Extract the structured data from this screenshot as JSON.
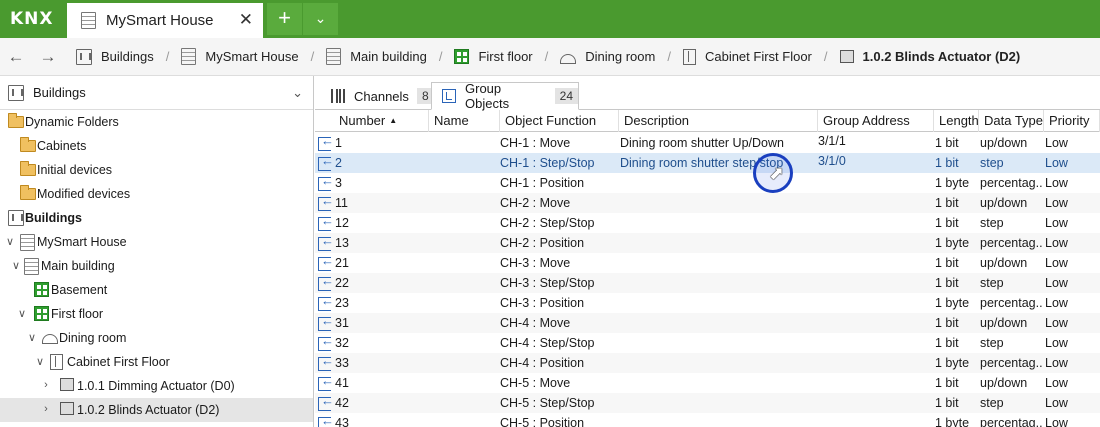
{
  "app": {
    "logo": "KNX"
  },
  "tab": {
    "title": "MySmart House",
    "close": "✕",
    "add": "+",
    "dropdown": "⌄"
  },
  "breadcrumb": {
    "back": "←",
    "forward": "→",
    "separator": "/",
    "items": [
      {
        "label": "Buildings",
        "icon": "buildings-icon"
      },
      {
        "label": "MySmart House",
        "icon": "house-icon"
      },
      {
        "label": "Main building",
        "icon": "building-icon"
      },
      {
        "label": "First floor",
        "icon": "floor-icon"
      },
      {
        "label": "Dining room",
        "icon": "room-icon"
      },
      {
        "label": "Cabinet First Floor",
        "icon": "cabinet-icon"
      },
      {
        "label": "1.0.2 Blinds Actuator (D2)",
        "icon": "device-icon"
      }
    ]
  },
  "left_panel": {
    "header": "Buildings",
    "tree": [
      {
        "label": "Dynamic Folders",
        "icon": "folder-icon",
        "level": 0,
        "expander": ""
      },
      {
        "label": "Cabinets",
        "icon": "folder-icon",
        "level": 1,
        "expander": ""
      },
      {
        "label": "Initial devices",
        "icon": "folder-icon",
        "level": 1,
        "expander": ""
      },
      {
        "label": "Modified devices",
        "icon": "folder-icon",
        "level": 1,
        "expander": ""
      },
      {
        "label": "Buildings",
        "icon": "buildings-icon",
        "level": 0,
        "expander": "",
        "bold": true
      },
      {
        "label": "MySmart House",
        "icon": "house-icon",
        "level": 1,
        "expander": "v"
      },
      {
        "label": "Main building",
        "icon": "building-icon",
        "level": 2,
        "expander": "v"
      },
      {
        "label": "Basement",
        "icon": "floor-icon",
        "level": 3,
        "expander": ""
      },
      {
        "label": "First floor",
        "icon": "floor-icon",
        "level": 3,
        "expander": "v"
      },
      {
        "label": "Dining room",
        "icon": "room-icon",
        "level": 4,
        "expander": "v"
      },
      {
        "label": "Cabinet First Floor",
        "icon": "cabinet-icon",
        "level": 5,
        "expander": "v"
      },
      {
        "label": "1.0.1 Dimming Actuator (D0)",
        "icon": "device-icon",
        "level": 6,
        "expander": ">"
      },
      {
        "label": "1.0.2 Blinds Actuator (D2)",
        "icon": "device-icon",
        "level": 6,
        "expander": ">",
        "selected": true
      }
    ]
  },
  "right_panel": {
    "tabs": [
      {
        "label": "Channels",
        "count": "8",
        "icon": "channels-icon"
      },
      {
        "label": "Group Objects",
        "count": "24",
        "icon": "group-objects-icon",
        "active": true
      }
    ],
    "columns": [
      "Number",
      "Name",
      "Object Function",
      "Description",
      "Group Address",
      "Length",
      "Data Type",
      "Priority"
    ],
    "sort_indicator": "▲",
    "rows": [
      {
        "number": "1",
        "name": "",
        "function": "CH-1 : Move",
        "description": "Dining room shutter Up/Down",
        "address": "3/1/1",
        "length": "1 bit",
        "datatype": "up/down",
        "priority": "Low"
      },
      {
        "number": "2",
        "name": "",
        "function": "CH-1 : Step/Stop",
        "description": "Dining room shutter step/stop",
        "address": "3/1/0",
        "length": "1 bit",
        "datatype": "step",
        "priority": "Low",
        "selected": true
      },
      {
        "number": "3",
        "name": "",
        "function": "CH-1 : Position",
        "description": "",
        "address": "",
        "length": "1 byte",
        "datatype": "percentag...",
        "priority": "Low"
      },
      {
        "number": "11",
        "name": "",
        "function": "CH-2 : Move",
        "description": "",
        "address": "",
        "length": "1 bit",
        "datatype": "up/down",
        "priority": "Low"
      },
      {
        "number": "12",
        "name": "",
        "function": "CH-2 : Step/Stop",
        "description": "",
        "address": "",
        "length": "1 bit",
        "datatype": "step",
        "priority": "Low"
      },
      {
        "number": "13",
        "name": "",
        "function": "CH-2 : Position",
        "description": "",
        "address": "",
        "length": "1 byte",
        "datatype": "percentag...",
        "priority": "Low"
      },
      {
        "number": "21",
        "name": "",
        "function": "CH-3 : Move",
        "description": "",
        "address": "",
        "length": "1 bit",
        "datatype": "up/down",
        "priority": "Low"
      },
      {
        "number": "22",
        "name": "",
        "function": "CH-3 : Step/Stop",
        "description": "",
        "address": "",
        "length": "1 bit",
        "datatype": "step",
        "priority": "Low"
      },
      {
        "number": "23",
        "name": "",
        "function": "CH-3 : Position",
        "description": "",
        "address": "",
        "length": "1 byte",
        "datatype": "percentag...",
        "priority": "Low"
      },
      {
        "number": "31",
        "name": "",
        "function": "CH-4 : Move",
        "description": "",
        "address": "",
        "length": "1 bit",
        "datatype": "up/down",
        "priority": "Low"
      },
      {
        "number": "32",
        "name": "",
        "function": "CH-4 : Step/Stop",
        "description": "",
        "address": "",
        "length": "1 bit",
        "datatype": "step",
        "priority": "Low"
      },
      {
        "number": "33",
        "name": "",
        "function": "CH-4 : Position",
        "description": "",
        "address": "",
        "length": "1 byte",
        "datatype": "percentag...",
        "priority": "Low"
      },
      {
        "number": "41",
        "name": "",
        "function": "CH-5 : Move",
        "description": "",
        "address": "",
        "length": "1 bit",
        "datatype": "up/down",
        "priority": "Low"
      },
      {
        "number": "42",
        "name": "",
        "function": "CH-5 : Step/Stop",
        "description": "",
        "address": "",
        "length": "1 bit",
        "datatype": "step",
        "priority": "Low"
      },
      {
        "number": "43",
        "name": "",
        "function": "CH-5 : Position",
        "description": "",
        "address": "",
        "length": "1 byte",
        "datatype": "percentag...",
        "priority": "Low"
      }
    ]
  },
  "colors": {
    "brand_green": "#4a9a2f",
    "selection_blue": "#dbe9f7",
    "cursor_ring": "#1a3fbf"
  }
}
